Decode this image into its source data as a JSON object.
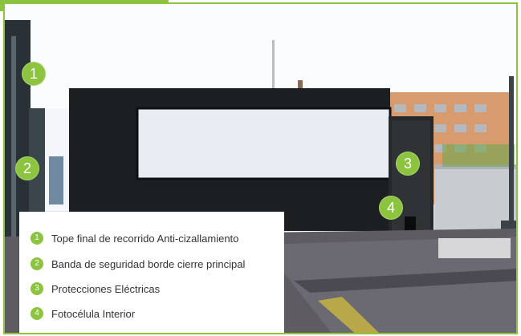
{
  "markers": [
    {
      "number": "1"
    },
    {
      "number": "2"
    },
    {
      "number": "3"
    },
    {
      "number": "4"
    }
  ],
  "legend": {
    "items": [
      {
        "number": "1",
        "label": "Tope final de recorrido Anti-cizallamiento"
      },
      {
        "number": "2",
        "label": "Banda de seguridad borde cierre principal"
      },
      {
        "number": "3",
        "label": "Protecciones Eléctricas"
      },
      {
        "number": "4",
        "label": "Fotocélula Interior"
      }
    ]
  },
  "colors": {
    "accent": "#8cc43f",
    "gate": "#1b1f22",
    "sky": "#f3f5f8"
  }
}
